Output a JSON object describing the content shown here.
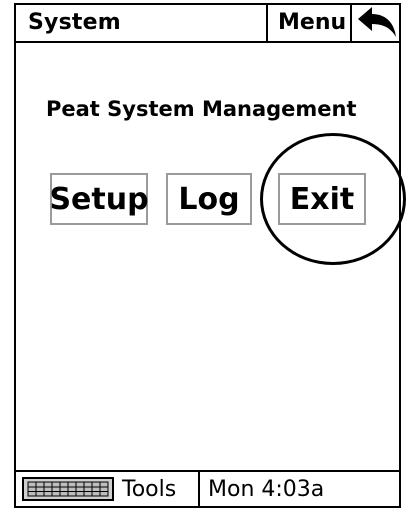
{
  "topbar": {
    "title": "System",
    "menu_label": "Menu",
    "back_icon": "back-arrow-icon"
  },
  "main": {
    "heading": "Peat System Management",
    "buttons": [
      {
        "label": "Setup"
      },
      {
        "label": "Log"
      },
      {
        "label": "Exit"
      }
    ]
  },
  "bottombar": {
    "keyboard_icon": "keyboard-icon",
    "tools_label": "Tools",
    "clock": "Mon 4:03a"
  }
}
